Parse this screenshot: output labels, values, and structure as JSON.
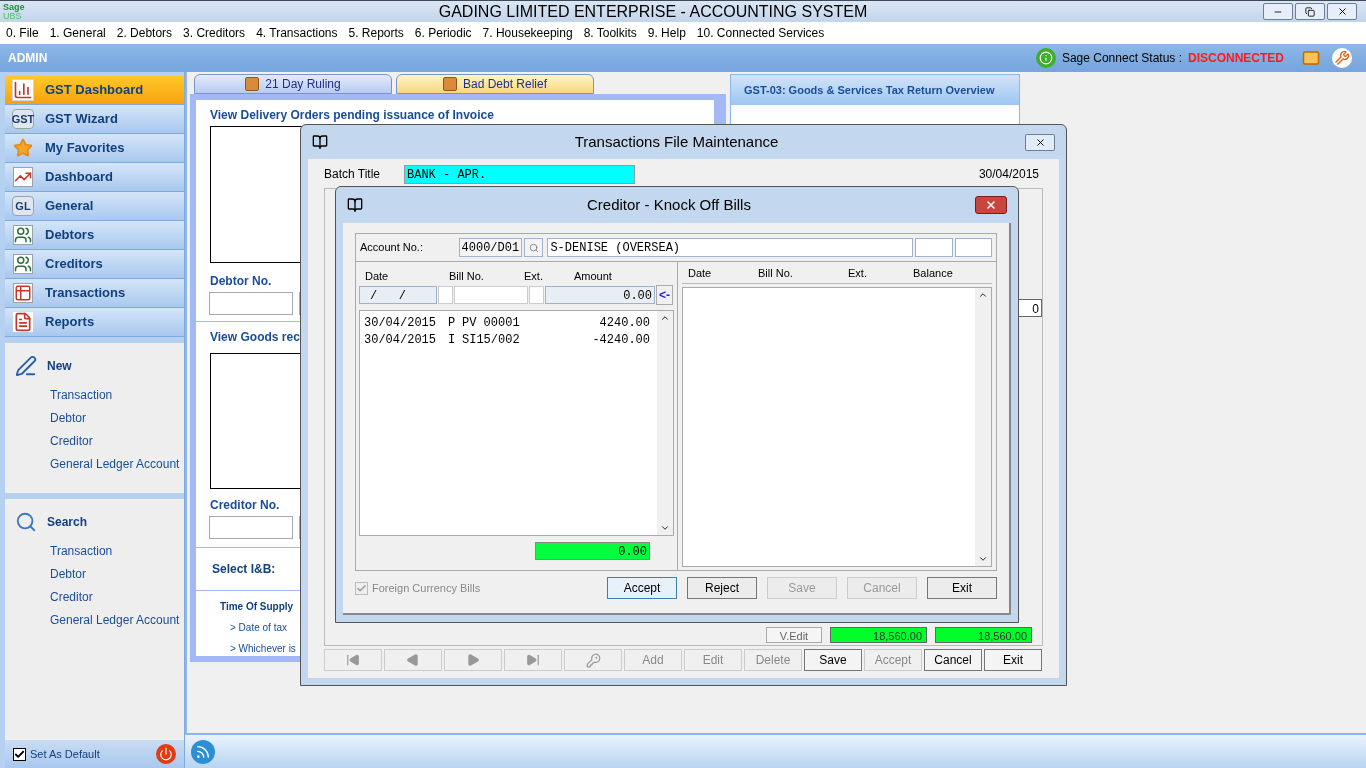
{
  "window": {
    "logo_top": "Sage",
    "logo_bottom": "UBS",
    "title": "GADING LIMITED ENTERPRISE - ACCOUNTING SYSTEM"
  },
  "menu": [
    "0. File",
    "1. General",
    "2. Debtors",
    "3. Creditors",
    "4. Transactions",
    "5. Reports",
    "6. Periodic",
    "7. Housekeeping",
    "8. Toolkits",
    "9. Help",
    "10. Connected Services"
  ],
  "header": {
    "user": "ADMIN",
    "status_label": "Sage Connect Status :",
    "status_value": "DISCONNECTED"
  },
  "sidebar": {
    "nav": [
      {
        "label": "GST Dashboard",
        "kind": "chart",
        "selected": true
      },
      {
        "label": "GST Wizard",
        "kind": "badge",
        "icon_text": "GST",
        "selected": false
      },
      {
        "label": "My Favorites",
        "kind": "star",
        "selected": false
      },
      {
        "label": "Dashboard",
        "kind": "line",
        "selected": false
      },
      {
        "label": "General",
        "kind": "badge",
        "icon_text": "GL",
        "selected": false
      },
      {
        "label": "Debtors",
        "kind": "people",
        "selected": false
      },
      {
        "label": "Creditors",
        "kind": "people",
        "selected": false
      },
      {
        "label": "Transactions",
        "kind": "ledger",
        "selected": false
      },
      {
        "label": "Reports",
        "kind": "report",
        "selected": false
      }
    ],
    "sections": [
      {
        "title": "New",
        "kind": "new",
        "links": [
          "Transaction",
          "Debtor",
          "Creditor",
          "General Ledger Account"
        ]
      },
      {
        "title": "Search",
        "kind": "search",
        "links": [
          "Transaction",
          "Debtor",
          "Creditor",
          "General Ledger Account"
        ]
      }
    ],
    "set_default": {
      "label": "Set As Default",
      "checked": true
    }
  },
  "tabs": [
    {
      "label": "21 Day Ruling",
      "selected": false
    },
    {
      "label": "Bad Debt Relief",
      "selected": true
    }
  ],
  "dashboard": {
    "delivery_title": "View Delivery Orders pending issuance of Invoice",
    "debtor_label": "Debtor No.",
    "goods_title": "View Goods rec",
    "creditor_label": "Creditor No.",
    "ib_label": "Select I&B:",
    "supply_title": "Time Of Supply",
    "supply_lines": [
      "> Date of tax",
      "> Whichever is"
    ]
  },
  "gst_panel": {
    "title": "GST-03: Goods & Services Tax Return Overview"
  },
  "transactions_dialog": {
    "title": "Transactions File Maintenance",
    "batch_label": "Batch Title",
    "batch_value": "BANK - APR.",
    "date": "30/04/2015",
    "side_value": "0",
    "edit_button": "V.Edit",
    "totals": [
      "18,560.00",
      "18,560.00"
    ],
    "nav_buttons": [
      {
        "kind": "first",
        "disabled": true
      },
      {
        "kind": "prev",
        "disabled": true
      },
      {
        "kind": "next",
        "disabled": true
      },
      {
        "kind": "last",
        "disabled": true
      },
      {
        "kind": "key",
        "disabled": true
      }
    ],
    "buttons": [
      {
        "label": "Add",
        "disabled": true
      },
      {
        "label": "Edit",
        "disabled": true
      },
      {
        "label": "Delete",
        "disabled": true
      },
      {
        "label": "Save",
        "disabled": false
      },
      {
        "label": "Accept",
        "disabled": true
      },
      {
        "label": "Cancel",
        "disabled": false
      },
      {
        "label": "Exit",
        "disabled": false
      }
    ]
  },
  "knockoff_dialog": {
    "title": "Creditor - Knock Off Bills",
    "account_label": "Account No.:",
    "account_no": "4000/D01",
    "account_name": "S-DENISE (OVERSEA)",
    "left_columns": [
      "Date",
      "Bill No.",
      "Ext.",
      "Amount"
    ],
    "entry_date": "/   /",
    "entry_amount": "0.00",
    "entry_arrow": "<-",
    "rows": [
      {
        "date": "30/04/2015",
        "type": "P",
        "bill_no": "PV 00001",
        "amount": "4240.00"
      },
      {
        "date": "30/04/2015",
        "type": "I",
        "bill_no": "SI15/002",
        "amount": "-4240.00"
      }
    ],
    "total": "0.00",
    "right_columns": [
      "Date",
      "Bill No.",
      "Ext.",
      "Balance"
    ],
    "foreign": {
      "label": "Foreign Currency Bills",
      "checked": true
    },
    "buttons": [
      {
        "label": "Accept",
        "disabled": false,
        "focused": true
      },
      {
        "label": "Reject",
        "disabled": false,
        "focused": false
      },
      {
        "label": "Save",
        "disabled": true,
        "focused": false
      },
      {
        "label": "Cancel",
        "disabled": true,
        "focused": false
      },
      {
        "label": "Exit",
        "disabled": false,
        "focused": false
      }
    ]
  }
}
